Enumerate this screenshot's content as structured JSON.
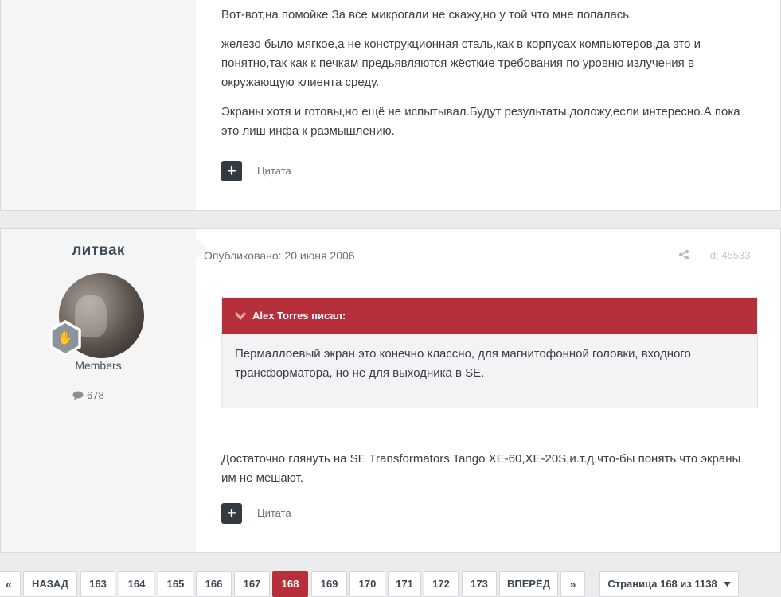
{
  "post1": {
    "paragraphs": [
      "Вот-вот,на помойке.За все микрогали не скажу,но у той что мне попалась",
      "железо было мягкое,а не конструкционная сталь,как в корпусах компьютеров,да это и понятно,так как к печкам предьявляются жёсткие требования по уровню излучения в окружающую клиента среду.",
      "Экраны хотя и готовы,но ещё не испытывал.Будут результаты,доложу,если интересно.А пока это лиш инфа к размышлению."
    ],
    "plus_label": "+",
    "quote_label": "Цитата"
  },
  "post2": {
    "author": "литвак",
    "group": "Members",
    "post_count": "678",
    "published": "Опубликовано: 20 июня 2006",
    "post_id": "id: 45533",
    "quote": {
      "author": "Alex Torres писал:",
      "text": "Пермаллоевый экран это конечно классно, для магнитофонной головки, входного трансформатора, но не для выходника в SE."
    },
    "body": "Достаточно глянуть на SE Transformators Tango XE-60,XE-20S,и.т.д.что-бы понять что экраны им не мешают.",
    "plus_label": "+",
    "quote_label": "Цитата"
  },
  "pagination": {
    "first": "«",
    "prev": "НАЗАД",
    "pages": [
      "163",
      "164",
      "165",
      "166",
      "167",
      "168",
      "169",
      "170",
      "171",
      "172",
      "173"
    ],
    "current": "168",
    "next": "ВПЕРЁД",
    "last": "»",
    "page_of": "Страница 168 из 1138"
  },
  "colors": {
    "accent": "#b5303a",
    "dark_button": "#333a40",
    "background": "#ebeced"
  },
  "icons": [
    "plus-icon",
    "chevron-down-icon",
    "share-icon",
    "comment-icon",
    "rank-hand-icon",
    "caret-down-icon"
  ]
}
